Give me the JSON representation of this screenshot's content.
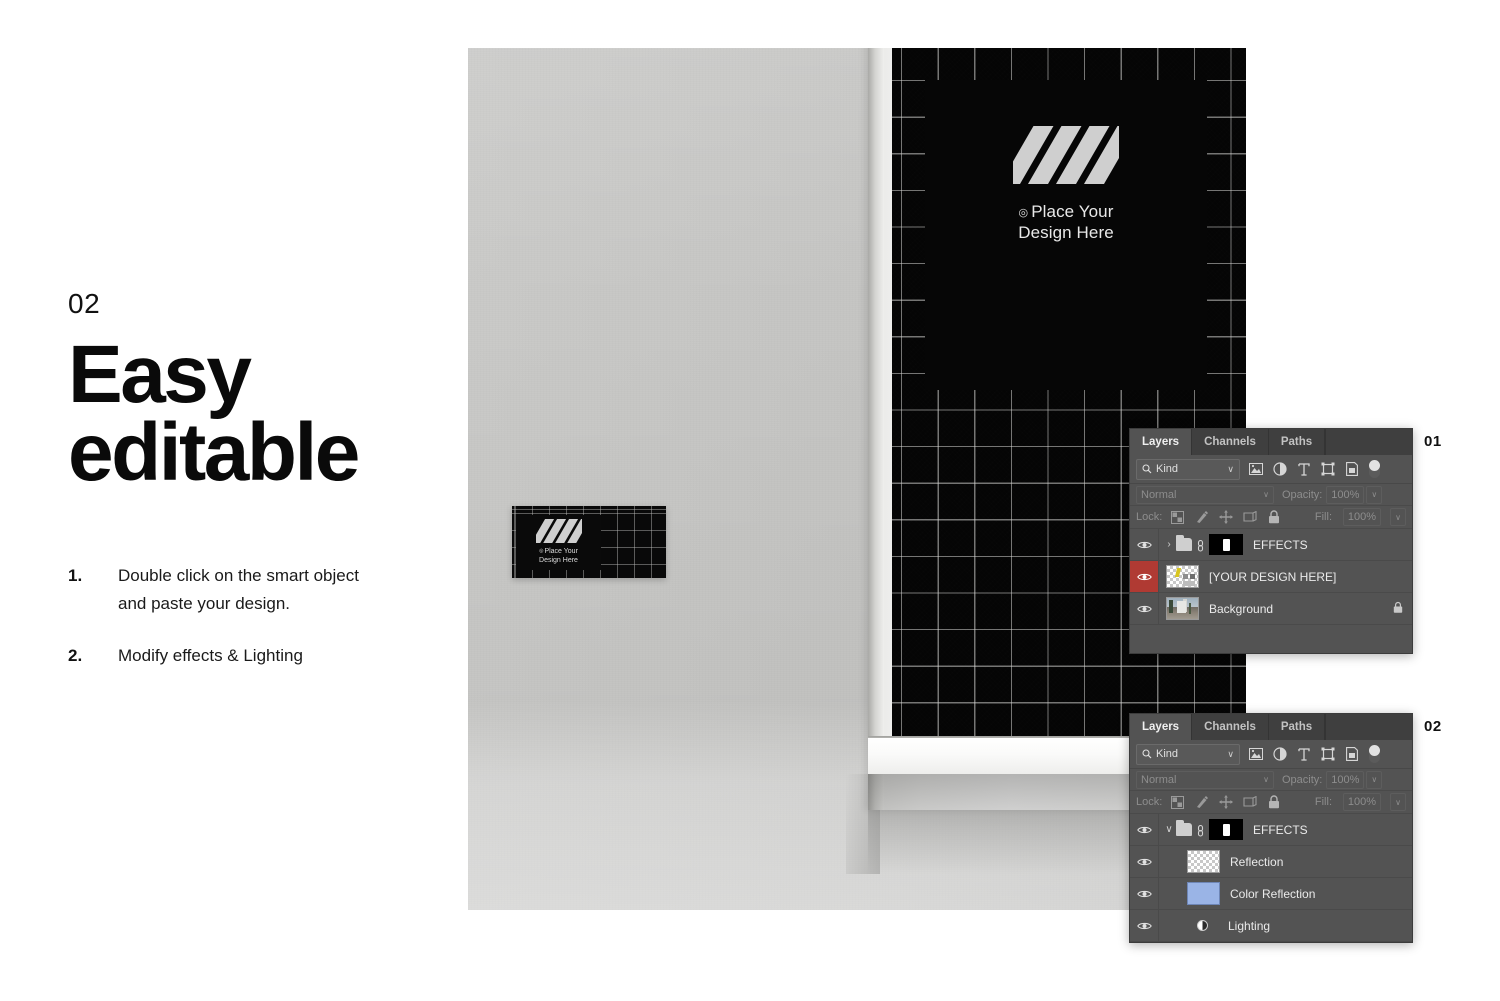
{
  "left": {
    "step_number": "02",
    "headline_line1": "Easy",
    "headline_line2": "editable",
    "instructions": [
      {
        "num": "1.",
        "text": "Double click on the smart object and paste your design."
      },
      {
        "num": "2.",
        "text": "Modify effects & Lighting"
      }
    ]
  },
  "mockup": {
    "poster": {
      "logo": "diagonal-stripes-logo",
      "caption_mark": "◎",
      "caption_line1": "Place Your",
      "caption_line2": "Design Here"
    },
    "card": {
      "caption_mark": "◎",
      "caption_line1": "Place Your",
      "caption_line2": "Design Here"
    }
  },
  "callouts": {
    "panel1": "01",
    "panel2": "02"
  },
  "panels": [
    {
      "id": "panel-1",
      "tabs": [
        {
          "label": "Layers",
          "active": true
        },
        {
          "label": "Channels",
          "active": false
        },
        {
          "label": "Paths",
          "active": false
        }
      ],
      "filter": {
        "kind_label": "Kind",
        "search_icon": "search-icon",
        "chevron": "∨",
        "icons": [
          "pixel-layer-filter-icon",
          "adjustment-layer-filter-icon",
          "type-layer-filter-icon",
          "shape-layer-filter-icon",
          "smart-object-filter-icon"
        ],
        "toggle": "filter-toggle"
      },
      "blend": {
        "mode": "Normal",
        "opacity_label": "Opacity:",
        "opacity_value": "100%"
      },
      "lock": {
        "label": "Lock:",
        "icons": [
          "lock-transparent-pixels-icon",
          "lock-image-pixels-icon",
          "lock-position-icon",
          "lock-artboard-icon",
          "lock-all-icon"
        ],
        "fill_label": "Fill:",
        "fill_value": "100%"
      },
      "layers": [
        {
          "name": "EFFECTS",
          "kind": "group",
          "visible": true,
          "expanded": false,
          "selected": false,
          "locked": false,
          "arrow": "›",
          "thumb": "folder",
          "mask": "black-mask"
        },
        {
          "name": "[YOUR DESIGN HERE]",
          "kind": "smart-object",
          "visible": true,
          "selected": true,
          "locked": false,
          "thumb": "checker"
        },
        {
          "name": "Background",
          "kind": "image",
          "visible": true,
          "selected": false,
          "locked": true,
          "thumb": "photo"
        }
      ]
    },
    {
      "id": "panel-2",
      "tabs": [
        {
          "label": "Layers",
          "active": true
        },
        {
          "label": "Channels",
          "active": false
        },
        {
          "label": "Paths",
          "active": false
        }
      ],
      "filter": {
        "kind_label": "Kind",
        "search_icon": "search-icon",
        "chevron": "∨",
        "icons": [
          "pixel-layer-filter-icon",
          "adjustment-layer-filter-icon",
          "type-layer-filter-icon",
          "shape-layer-filter-icon",
          "smart-object-filter-icon"
        ],
        "toggle": "filter-toggle"
      },
      "blend": {
        "mode": "Normal",
        "opacity_label": "Opacity:",
        "opacity_value": "100%"
      },
      "lock": {
        "label": "Lock:",
        "icons": [
          "lock-transparent-pixels-icon",
          "lock-image-pixels-icon",
          "lock-position-icon",
          "lock-artboard-icon",
          "lock-all-icon"
        ],
        "fill_label": "Fill:",
        "fill_value": "100%"
      },
      "layers": [
        {
          "name": "EFFECTS",
          "kind": "group",
          "visible": true,
          "expanded": true,
          "selected": false,
          "locked": false,
          "arrow": "∨",
          "thumb": "folder",
          "mask": "black-mask"
        },
        {
          "name": "Reflection",
          "kind": "pixel",
          "visible": true,
          "selected": false,
          "locked": false,
          "thumb": "checker-plain"
        },
        {
          "name": "Color Reflection",
          "kind": "pixel",
          "visible": true,
          "selected": false,
          "locked": false,
          "thumb": "blue"
        },
        {
          "name": "Lighting",
          "kind": "adjustment",
          "visible": true,
          "selected": false,
          "locked": false,
          "thumb": "adjustment-disc"
        }
      ]
    }
  ],
  "colors": {
    "page_background": "#ffffff",
    "panel_background": "#535353",
    "panel_tab_background": "#3f3f3f",
    "selected_layer": "#b03a33",
    "wall": "#c4c4c2",
    "artwork": "#050505",
    "color_reflection_thumb": "#9ab4e6",
    "text": "#111111"
  }
}
